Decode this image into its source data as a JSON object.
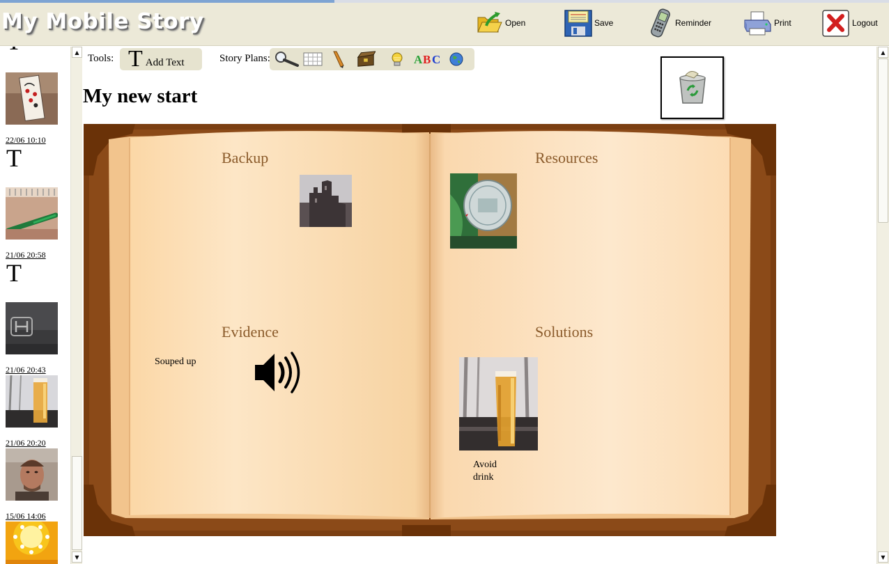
{
  "header": {
    "title": "My Mobile Story",
    "buttons": {
      "open": "Open",
      "save": "Save",
      "reminder": "Reminder",
      "print": "Print",
      "logout": "Logout"
    }
  },
  "sidebar": {
    "items": [
      {
        "date": "",
        "type": "photo",
        "icon": "playing-card-photo"
      },
      {
        "date": "22/06 10:10",
        "type": "text",
        "icon": "text-T-icon"
      },
      {
        "date": "",
        "type": "photo",
        "icon": "pen-on-notebook-photo"
      },
      {
        "date": "21/06 20:58",
        "type": "text",
        "icon": "text-T-icon"
      },
      {
        "date": "",
        "type": "photo",
        "icon": "car-steering-wheel-photo"
      },
      {
        "date": "21/06 20:43",
        "type": "photo",
        "icon": "beer-glass-photo"
      },
      {
        "date": "21/06 20:20",
        "type": "photo",
        "icon": "man-face-photo"
      },
      {
        "date": "15/06 14:06",
        "type": "photo",
        "icon": "yellow-lights-photo"
      }
    ],
    "text_glyph": "T"
  },
  "toolbar": {
    "tools_label": "Tools:",
    "add_text_glyph": "T",
    "add_text_label": "Add Text",
    "story_plans_label": "Story Plans:",
    "plan_icons": [
      "magnifier-icon",
      "grid-icon",
      "pencil-icon",
      "treasure-chest-icon",
      "lightbulb-icon",
      "abc-icon",
      "globe-icon"
    ],
    "abc_text": "ABC"
  },
  "story": {
    "title": "My new start"
  },
  "book": {
    "quadrants": [
      {
        "title": "Backup",
        "items": [
          {
            "type": "photo",
            "icon": "castle-building-photo"
          }
        ]
      },
      {
        "title": "Resources",
        "items": [
          {
            "type": "photo",
            "icon": "medal-coin-photo"
          }
        ]
      },
      {
        "title": "Evidence",
        "items": [
          {
            "type": "text",
            "text": "Souped up"
          },
          {
            "type": "audio",
            "icon": "speaker-icon"
          }
        ]
      },
      {
        "title": "Solutions",
        "items": [
          {
            "type": "photo",
            "icon": "beer-glass-photo"
          },
          {
            "type": "text",
            "text": "Avoid drink"
          }
        ]
      }
    ]
  },
  "colors": {
    "header_bg": "#ece9d8",
    "book_cover": "#7a3f12",
    "page": "#fde4c2",
    "quadrant_title": "#8a5a2a"
  }
}
